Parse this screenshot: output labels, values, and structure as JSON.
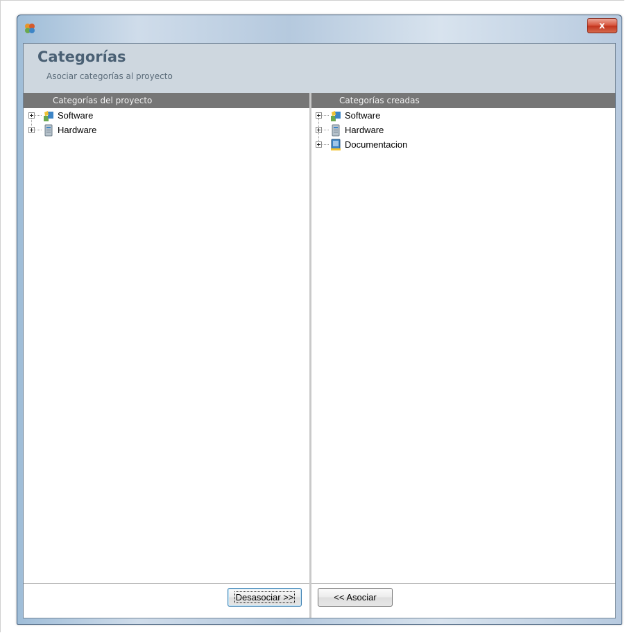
{
  "window": {
    "close_label": "x"
  },
  "header": {
    "title": "Categorías",
    "subtitle": "Asociar categorías al proyecto"
  },
  "left_panel": {
    "header": "Categorías del proyecto",
    "items": [
      {
        "label": "Software",
        "icon": "software-icon"
      },
      {
        "label": "Hardware",
        "icon": "hardware-icon"
      }
    ],
    "button_label": "Desasociar >>"
  },
  "right_panel": {
    "header": "Categorías creadas",
    "items": [
      {
        "label": "Software",
        "icon": "software-icon"
      },
      {
        "label": "Hardware",
        "icon": "hardware-icon"
      },
      {
        "label": "Documentacion",
        "icon": "documentation-icon"
      }
    ],
    "button_label": "<< Asociar"
  },
  "colors": {
    "column_header_bg": "#767676",
    "header_panel_bg": "#ced7df",
    "title_color": "#4a6074"
  }
}
